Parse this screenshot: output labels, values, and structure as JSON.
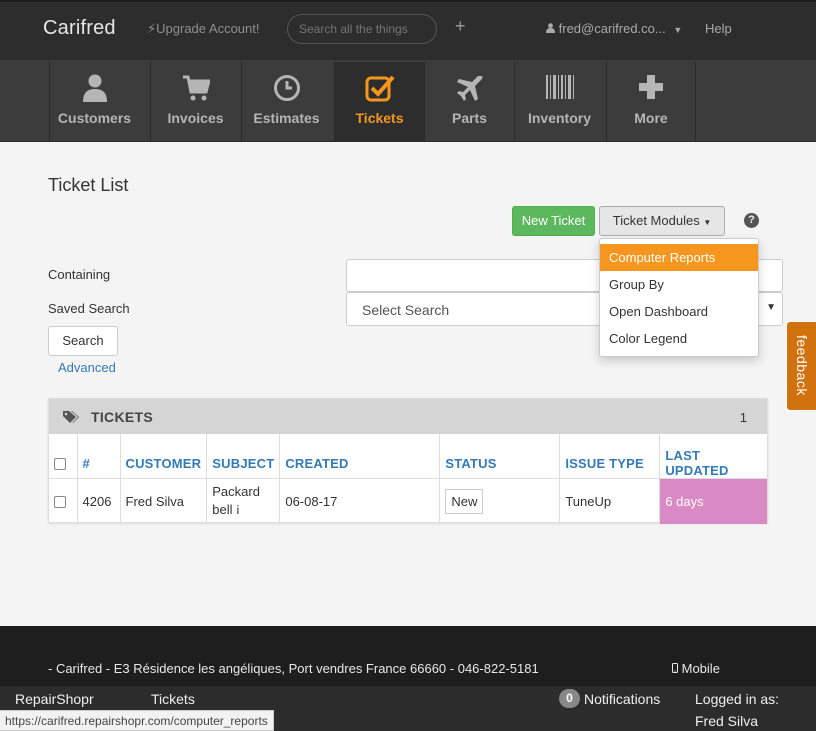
{
  "topbar": {
    "brand": "Carifred",
    "upgrade": "Upgrade Account!",
    "search_placeholder": "Search all the things",
    "plus": "+",
    "user": "fred@carifred.co...",
    "help": "Help"
  },
  "nav": {
    "items": [
      {
        "label": "Customers",
        "icon": "user-icon"
      },
      {
        "label": "Invoices",
        "icon": "cart-icon"
      },
      {
        "label": "Estimates",
        "icon": "clock-icon"
      },
      {
        "label": "Tickets",
        "icon": "checkbox-icon",
        "active": true
      },
      {
        "label": "Parts",
        "icon": "plane-icon"
      },
      {
        "label": "Inventory",
        "icon": "barcode-icon"
      },
      {
        "label": "More",
        "icon": "plus-icon"
      }
    ],
    "active_color": "#f5961e"
  },
  "main": {
    "title": "Ticket List",
    "new_ticket": "New Ticket",
    "ticket_modules": "Ticket Modules",
    "help_icon": "?",
    "dropdown": [
      "Computer Reports",
      "Group By",
      "Open Dashboard",
      "Color Legend"
    ],
    "containing_label": "Containing",
    "containing_value": "",
    "saved_search_label": "Saved Search",
    "saved_search_value": "Select Search",
    "search_button": "Search",
    "advanced_link": "Advanced",
    "feedback": "feedback"
  },
  "panel": {
    "title": "TICKETS",
    "count": "1",
    "columns": [
      "#",
      "CUSTOMER",
      "SUBJECT",
      "CREATED",
      "STATUS",
      "ISSUE TYPE",
      "LAST UPDATED"
    ],
    "rows": [
      {
        "number": "4206",
        "customer": "Fred Silva",
        "subject": "Packard bell",
        "info": "i",
        "created": "06-08-17",
        "status": "New",
        "issue_type": "TuneUp",
        "last_updated": "6 days"
      }
    ]
  },
  "footer": {
    "address": "- Carifred - E3 Résidence les angéliques, Port vendres France 66660 - 046-822-5181",
    "mobile": "Mobile"
  },
  "bottombar": {
    "brand": "RepairShopr",
    "tickets": "Tickets",
    "notification_count": "0",
    "notifications": "Notifications",
    "logged_in": "Logged in as:",
    "user_name": "Fred Silva"
  },
  "statusbar": {
    "url": "https://carifred.repairshopr.com/computer_reports"
  },
  "colors": {
    "topbar": "#2d2d2d",
    "nav": "#3c3c3c",
    "accent": "#f5961e",
    "green": "#5cb85c",
    "link": "#337ab7",
    "last_updated_cell": "#d98ac4",
    "feedback": "#d2720f"
  }
}
